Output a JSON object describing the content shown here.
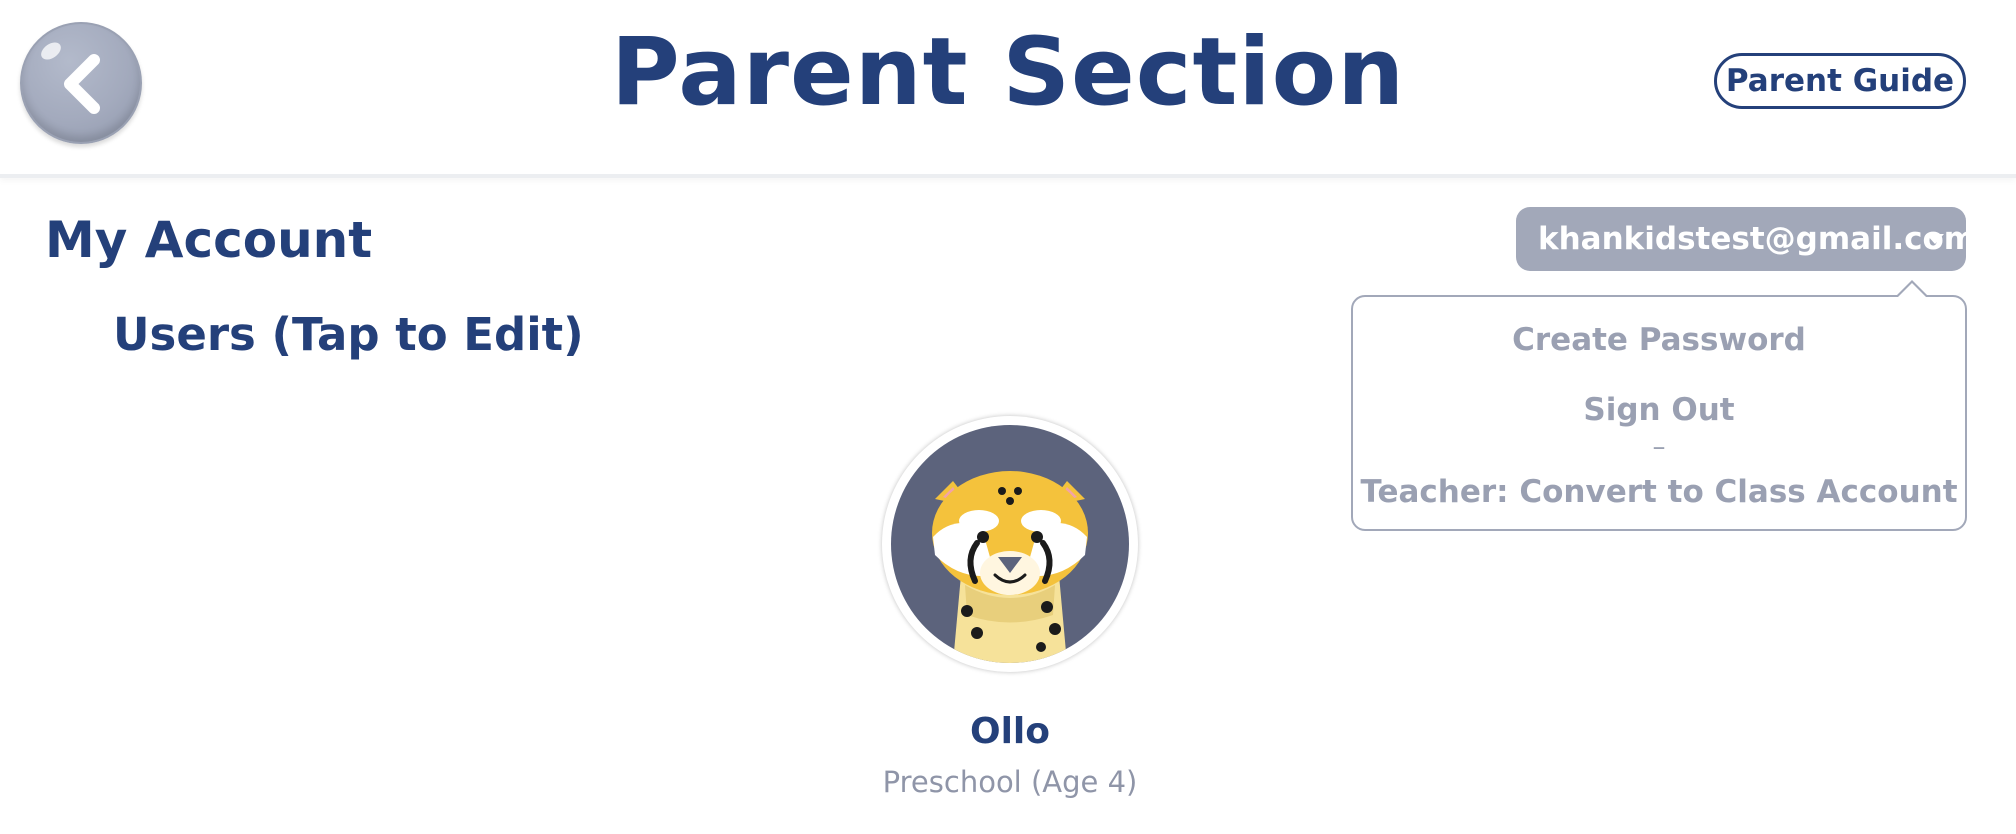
{
  "header": {
    "title": "Parent Section",
    "parent_guide_label": "Parent Guide",
    "back_icon": "chevron-left-icon"
  },
  "account": {
    "section_title": "My Account",
    "email": "khankidstest@gmail.com",
    "menu": {
      "create_password": "Create Password",
      "sign_out": "Sign Out",
      "separator": "–",
      "teacher_convert": "Teacher: Convert to Class Account"
    }
  },
  "users": {
    "title": "Users (Tap to Edit)",
    "list": [
      {
        "name": "Ollo",
        "grade": "Preschool (Age 4)",
        "avatar_icon": "cheetah-avatar-icon"
      }
    ]
  },
  "colors": {
    "navy": "#24407a",
    "gray": "#a2a8b9",
    "avatar_bg": "#5c637c",
    "cheetah_yellow": "#f4c23c"
  }
}
